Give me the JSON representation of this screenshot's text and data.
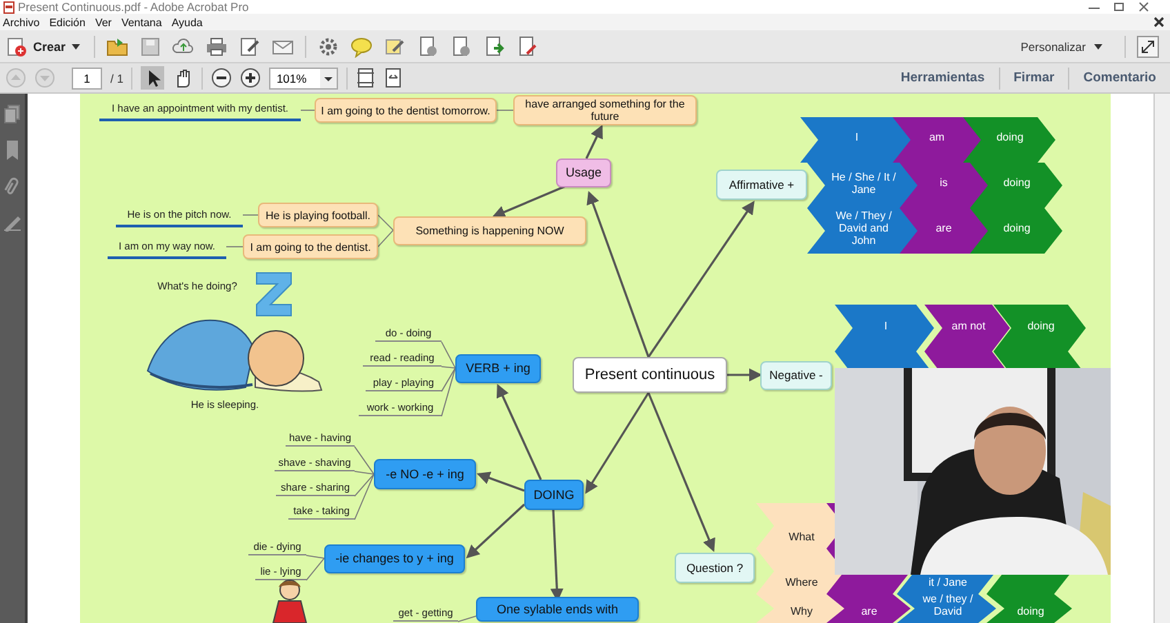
{
  "window": {
    "title": "Present Continuous.pdf - Adobe Acrobat Pro"
  },
  "menu": [
    "Archivo",
    "Edición",
    "Ver",
    "Ventana",
    "Ayuda"
  ],
  "toolbar": {
    "create": "Crear",
    "customize": "Personalizar"
  },
  "nav": {
    "page": "1",
    "pages": "/ 1",
    "zoom": "101%",
    "panels": [
      "Herramientas",
      "Firmar",
      "Comentario"
    ]
  },
  "mind_map": {
    "nodes": [
      {
        "text": "I am going to the dentist tomorrow.",
        "kind": "peach"
      },
      {
        "text": "have arranged something for the future",
        "kind": "peach"
      },
      {
        "text": "Usage",
        "kind": "pink"
      },
      {
        "text": "Something is happening NOW",
        "kind": "peach"
      },
      {
        "text": "He is playing football.",
        "kind": "peach"
      },
      {
        "text": "I am going to the dentist.",
        "kind": "peach"
      },
      {
        "text": "Present continuous",
        "kind": "central"
      },
      {
        "text": "Affirmative +",
        "kind": "cyan"
      },
      {
        "text": "Negative -",
        "kind": "cyan"
      },
      {
        "text": "Question ?",
        "kind": "cyan"
      },
      {
        "text": "VERB + ing",
        "kind": "blue"
      },
      {
        "text": "DOING",
        "kind": "blue"
      },
      {
        "text": "-e  NO -e + ing",
        "kind": "blue"
      },
      {
        "text": "-ie changes to y + ing",
        "kind": "blue"
      },
      {
        "text": "One sylable ends with",
        "kind": "blue"
      }
    ],
    "examples": [
      {
        "text": "I have an appointment with my dentist.",
        "kind": "sentence"
      },
      {
        "text": "He is on the pitch now.",
        "kind": "sentence"
      },
      {
        "text": "I am on my way now.",
        "kind": "sentence"
      },
      {
        "text": "do - doing",
        "kind": "word"
      },
      {
        "text": "read - reading",
        "kind": "word"
      },
      {
        "text": "play - playing",
        "kind": "word"
      },
      {
        "text": "work - working",
        "kind": "word"
      },
      {
        "text": "have - having",
        "kind": "word"
      },
      {
        "text": "shave - shaving",
        "kind": "word"
      },
      {
        "text": "share - sharing",
        "kind": "word"
      },
      {
        "text": "take - taking",
        "kind": "word"
      },
      {
        "text": "die - dying",
        "kind": "word"
      },
      {
        "text": "lie - lying",
        "kind": "word"
      },
      {
        "text": "get - getting",
        "kind": "word"
      }
    ],
    "captions": [
      "What's he doing?",
      "He is sleeping."
    ],
    "grids": [
      {
        "rows": [
          [
            {
              "text": "I",
              "color": "#1b78c8"
            },
            {
              "text": "am",
              "color": "#8e1a9c"
            },
            {
              "text": "doing",
              "color": "#139127"
            }
          ],
          [
            {
              "text": "He / She / It / Jane",
              "color": "#1b78c8"
            },
            {
              "text": "is",
              "color": "#8e1a9c"
            },
            {
              "text": "doing",
              "color": "#139127"
            }
          ],
          [
            {
              "text": "We / They / David and John",
              "color": "#1b78c8"
            },
            {
              "text": "are",
              "color": "#8e1a9c"
            },
            {
              "text": "doing",
              "color": "#139127"
            }
          ]
        ]
      },
      {
        "rows": [
          [
            {
              "text": "I",
              "color": "#1b78c8"
            },
            {
              "text": "am not",
              "color": "#8e1a9c"
            },
            {
              "text": "doing",
              "color": "#139127"
            }
          ],
          [
            {
              "color": "#1b78c8"
            },
            {
              "color": "#8e1a9c"
            },
            {
              "color": "#139127"
            }
          ]
        ]
      },
      {
        "rows": [
          [
            {
              "text": "What",
              "color": "#fde1bd"
            },
            {
              "color": "#8e1a9c"
            }
          ],
          [
            {
              "text": "Where",
              "color": "#fde1bd"
            },
            {
              "color": "#8e1a9c"
            },
            {
              "text": "it / Jane",
              "color": "#1b78c8"
            },
            {
              "color": "#139127"
            }
          ],
          [
            {
              "text": "Why",
              "color": "#fde1bd"
            },
            {
              "text": "are",
              "color": "#8e1a9c"
            },
            {
              "text": "we / they / David",
              "color": "#1b78c8"
            },
            {
              "text": "doing",
              "color": "#139127"
            }
          ]
        ]
      }
    ]
  }
}
